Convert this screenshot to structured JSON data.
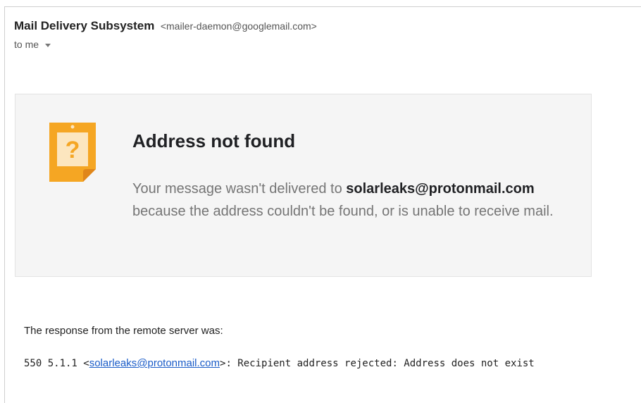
{
  "header": {
    "sender_name": "Mail Delivery Subsystem",
    "sender_email": "<mailer-daemon@googlemail.com>",
    "to_label": "to me"
  },
  "notice": {
    "icon": "question-note-icon",
    "icon_glyph": "?",
    "icon_color": "#f5a623",
    "title": "Address not found",
    "text_before": "Your message wasn't delivered to ",
    "recipient": "solarleaks@protonmail.com",
    "text_after": " because the address couldn't be found, or is unable to receive mail."
  },
  "response": {
    "label": "The response from the remote server was:",
    "code_prefix": "550 5.1.1 <",
    "code_link": "solarleaks@protonmail.com",
    "code_suffix": ">: Recipient address rejected: Address does not exist"
  }
}
